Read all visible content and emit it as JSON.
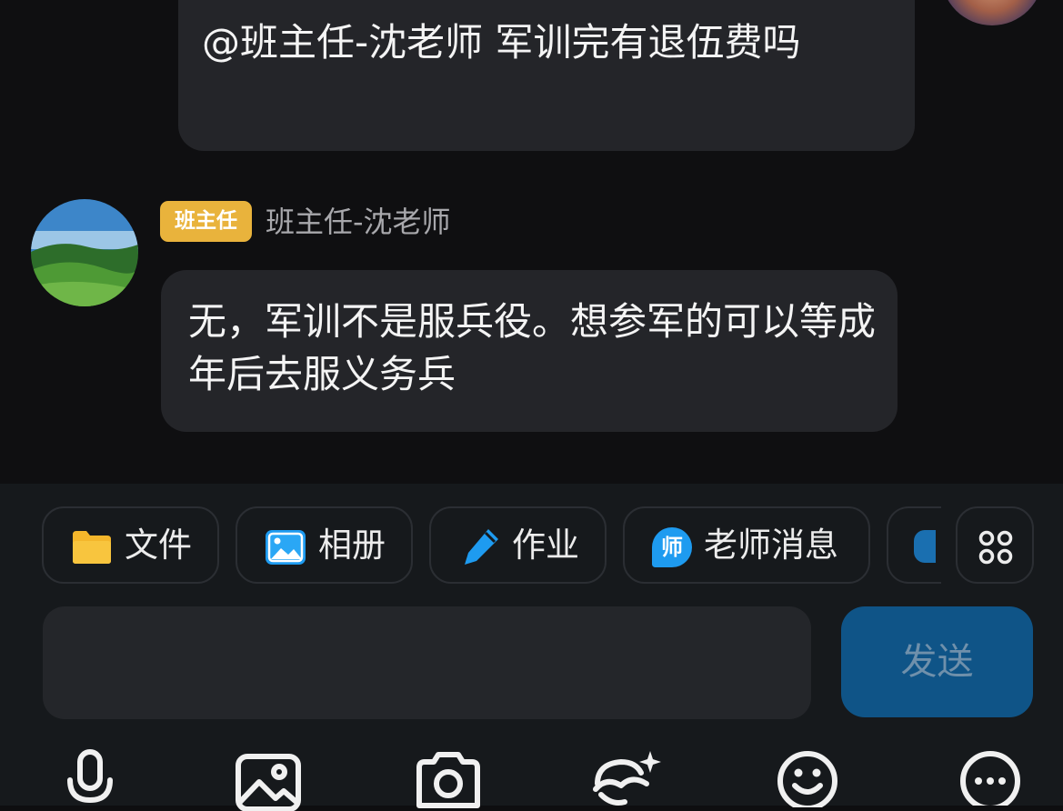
{
  "messages": [
    {
      "text": "@班主任-沈老师 军训完有退伍费吗",
      "from": "self"
    },
    {
      "text": "无，军训不是服兵役。想参军的可以等成年后去服义务兵",
      "from": "班主任-沈老师"
    }
  ],
  "sender": {
    "badge": "班主任",
    "name": "班主任-沈老师"
  },
  "toolbar": {
    "chips": [
      {
        "label": "文件",
        "icon": "folder-icon"
      },
      {
        "label": "相册",
        "icon": "album-icon"
      },
      {
        "label": "作业",
        "icon": "pencil-icon"
      },
      {
        "label": "老师消息",
        "icon": "teacher-message-icon",
        "icon_text": "师"
      }
    ],
    "more_icon": "grid-more-icon"
  },
  "composer": {
    "input_value": "",
    "send_label": "发送"
  },
  "bottom_bar": [
    "microphone-icon",
    "image-icon",
    "camera-icon",
    "magic-icon",
    "emoji-icon",
    "more-circle-icon"
  ],
  "colors": {
    "background": "#0f0f11",
    "bubble": "#242529",
    "badge": "#e9b33c",
    "send_button": "#0f5487",
    "accent_blue": "#1e9bf0",
    "folder": "#f4b62b"
  }
}
